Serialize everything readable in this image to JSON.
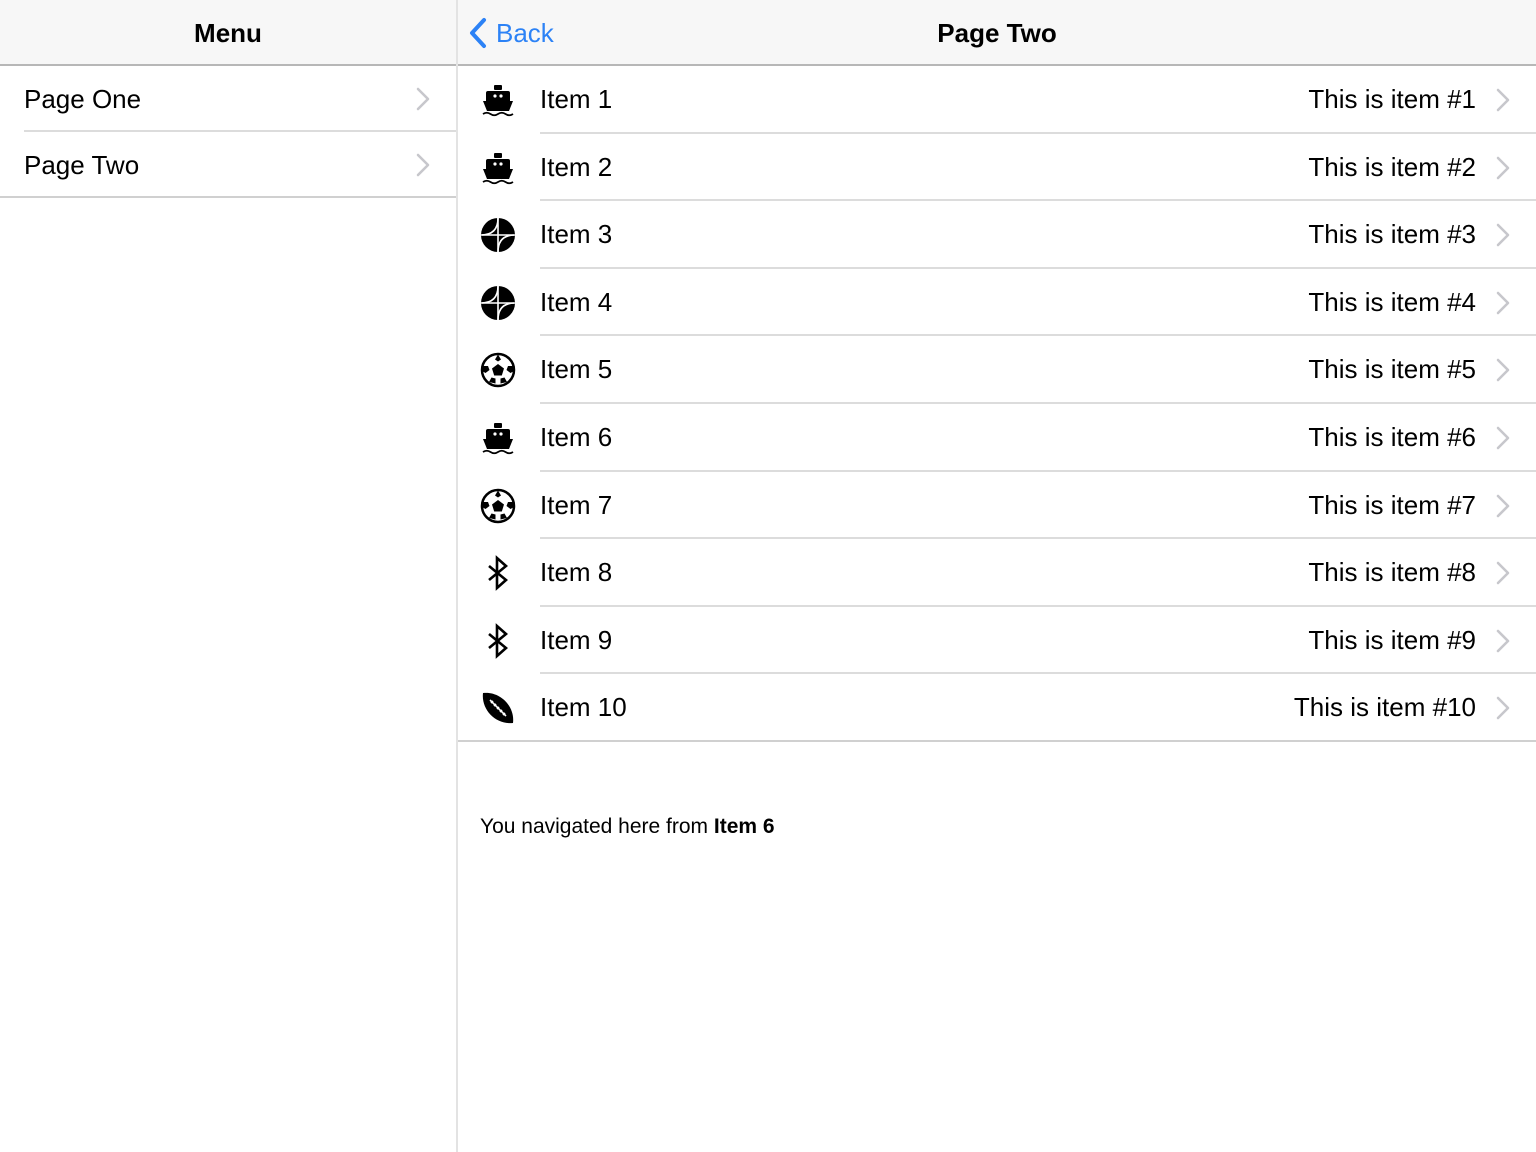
{
  "master": {
    "title": "Menu",
    "items": [
      {
        "label": "Page One"
      },
      {
        "label": "Page Two"
      }
    ]
  },
  "detail": {
    "title": "Page Two",
    "back_label": "Back",
    "items": [
      {
        "title": "Item 1",
        "detail": "This is item #1",
        "icon": "ship-icon"
      },
      {
        "title": "Item 2",
        "detail": "This is item #2",
        "icon": "ship-icon"
      },
      {
        "title": "Item 3",
        "detail": "This is item #3",
        "icon": "basketball-icon"
      },
      {
        "title": "Item 4",
        "detail": "This is item #4",
        "icon": "basketball-icon"
      },
      {
        "title": "Item 5",
        "detail": "This is item #5",
        "icon": "soccer-ball-icon"
      },
      {
        "title": "Item 6",
        "detail": "This is item #6",
        "icon": "ship-icon"
      },
      {
        "title": "Item 7",
        "detail": "This is item #7",
        "icon": "soccer-ball-icon"
      },
      {
        "title": "Item 8",
        "detail": "This is item #8",
        "icon": "bluetooth-icon"
      },
      {
        "title": "Item 9",
        "detail": "This is item #9",
        "icon": "bluetooth-icon"
      },
      {
        "title": "Item 10",
        "detail": "This is item #10",
        "icon": "football-icon"
      }
    ],
    "footer_prefix": "You navigated here from",
    "footer_item": "Item 6"
  },
  "colors": {
    "accent": "#2c82f6",
    "navbar_bg": "#f7f7f7",
    "separator": "#dcdcdc",
    "chevron": "#c7c7cc"
  }
}
